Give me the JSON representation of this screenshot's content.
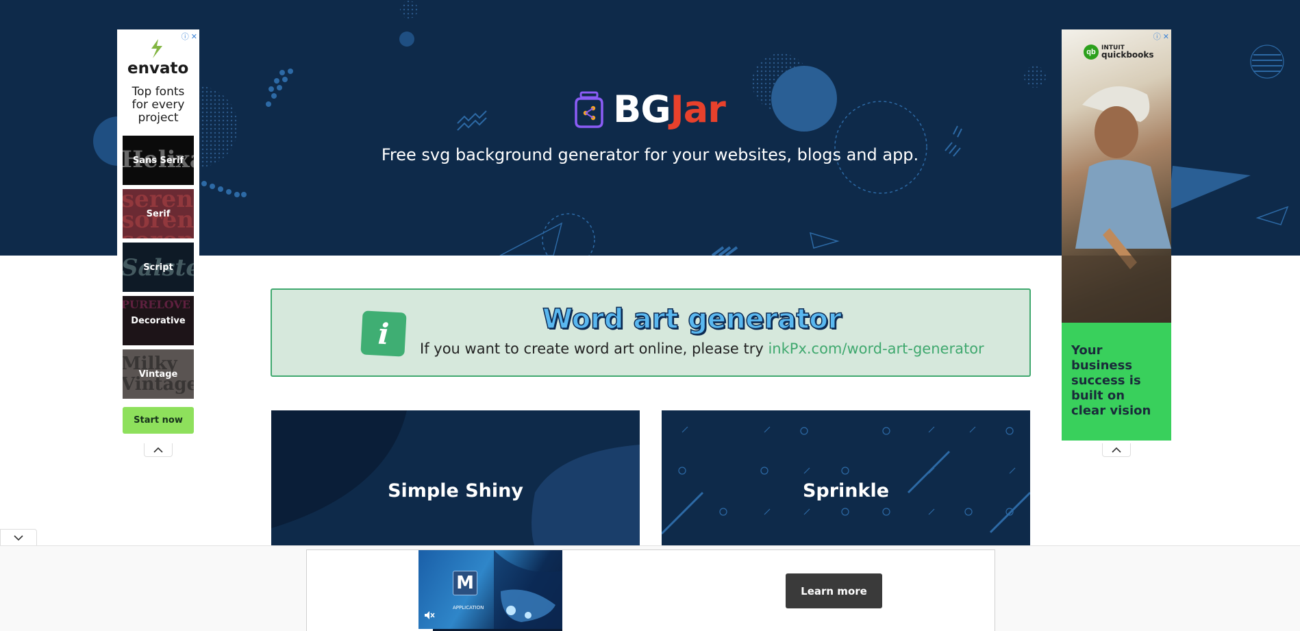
{
  "header": {
    "brand_first": "BG",
    "brand_second": "Jar",
    "tagline": "Free svg background generator for your websites, blogs and app."
  },
  "info_banner": {
    "icon_letter": "i",
    "title": "Word art generator",
    "text": "If you want to create word art online, please try",
    "link": "inkPx.com/word-art-generator"
  },
  "cards": [
    {
      "label": "Simple Shiny"
    },
    {
      "label": "Sprinkle"
    }
  ],
  "ad_left": {
    "brand": "envato",
    "headline": "Top fonts for every project",
    "tiles": [
      {
        "label": "Sans Serif",
        "bg_text": "Helixa"
      },
      {
        "label": "Serif",
        "bg_text": "seren soren sorop"
      },
      {
        "label": "Script",
        "bg_text": "Salster"
      },
      {
        "label": "Decorative",
        "bg_text": "PURELOVE"
      },
      {
        "label": "Vintage",
        "bg_text": "Milky Vintage"
      }
    ],
    "cta": "Start now",
    "ad_choice_icons": "ⓘ ✕"
  },
  "ad_right": {
    "brand_small": "INTUIT",
    "brand_large": "quickbooks",
    "logo_letters": "qb",
    "slogan": "Your business success is built on clear vision",
    "ad_choice_icons": "ⓘ ✕"
  },
  "bottom_ad": {
    "logo_letter": "M",
    "caption": "APPLICATION",
    "cta": "Learn more"
  },
  "icons": {
    "collapse_up": "chevron-up-icon",
    "collapse_down": "chevron-down-icon",
    "mute": "mute-icon"
  },
  "colors": {
    "hero_bg": "#0e2a4a",
    "brand_accent": "#e8412c",
    "banner_bg": "#d6e8dc",
    "banner_border": "#3fa86e",
    "envato_green": "#8ee05c",
    "quickbooks_green": "#39d05c"
  }
}
